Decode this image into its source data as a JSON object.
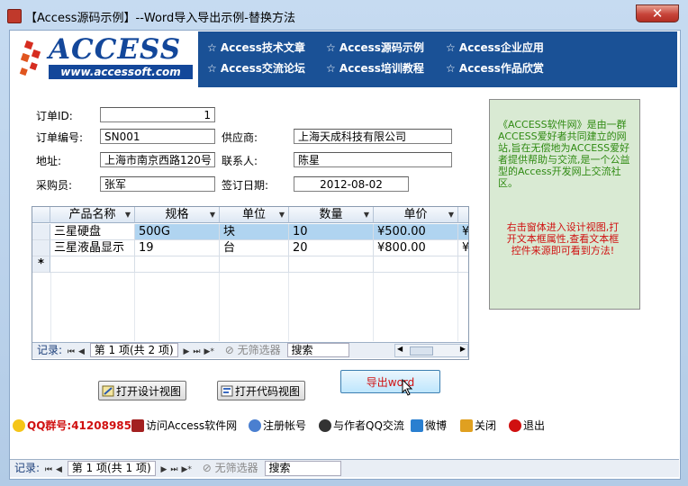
{
  "window": {
    "title": "【Access源码示例】--Word导入导出示例-替换方法",
    "close_glyph": "✕"
  },
  "banner": {
    "logo_text": "ACCESS",
    "logo_url": "www.accessoft.com",
    "links": [
      "☆ Access技术文章",
      "☆ Access源码示例",
      "☆ Access企业应用",
      "☆ Access交流论坛",
      "☆ Access培训教程",
      "☆ Access作品欣赏"
    ]
  },
  "form": {
    "order_id": {
      "label": "订单ID:",
      "value": "1"
    },
    "order_no": {
      "label": "订单编号:",
      "value": "SN001"
    },
    "supplier": {
      "label": "供应商:",
      "value": "上海天成科技有限公司"
    },
    "address": {
      "label": "地址:",
      "value": "上海市南京西路120号"
    },
    "contact": {
      "label": "联系人:",
      "value": "陈星"
    },
    "buyer": {
      "label": "采购员:",
      "value": "张军"
    },
    "sign_date": {
      "label": "签订日期:",
      "value": "2012-08-02"
    }
  },
  "info": {
    "green_text": "《ACCESS软件网》是由一群ACCESS爱好者共同建立的网站,旨在无偿地为ACCESS爱好者提供帮助与交流,是一个公益型的Access开发网上交流社区。",
    "red_text": "右击窗体进入设计视图,打开文本框属性,查看文本框控件来源即可看到方法!"
  },
  "grid": {
    "columns": [
      "产品名称",
      "规格",
      "单位",
      "数量",
      "单价"
    ],
    "rows": [
      [
        "三星硬盘",
        "500G",
        "块",
        "10",
        "¥500.00",
        "¥"
      ],
      [
        "三星液晶显示",
        "19",
        "台",
        "20",
        "¥800.00",
        "¥"
      ]
    ],
    "new_row_marker": "*",
    "nav": {
      "label": "记录:",
      "position": "第 1 项(共 2 项)",
      "filter": "无筛选器",
      "search": "搜索"
    }
  },
  "buttons": {
    "design_view": "打开设计视图",
    "code_view": "打开代码视图",
    "export_word": "导出word"
  },
  "footer": {
    "qq": "QQ群号:41208985",
    "links": [
      "访问Access软件网",
      "注册帐号",
      "与作者QQ交流",
      "微博",
      "关闭",
      "退出"
    ]
  },
  "form_nav": {
    "label": "记录:",
    "position": "第 1 项(共 1 项)",
    "filter": "无筛选器",
    "search": "搜索"
  }
}
